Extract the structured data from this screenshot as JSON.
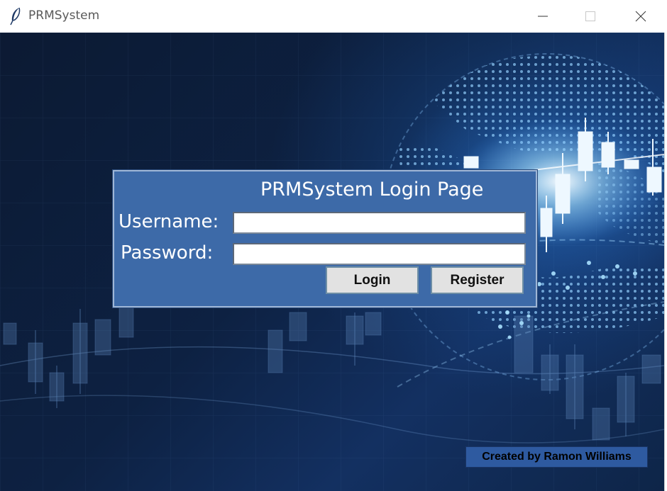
{
  "window": {
    "title": "PRMSystem",
    "controls": {
      "minimize_icon": "minimize-icon",
      "maximize_icon": "maximize-icon",
      "close_icon": "close-icon"
    }
  },
  "login": {
    "title": "PRMSystem Login Page",
    "username_label": "Username:",
    "password_label": "Password:",
    "username_value": "",
    "password_value": "",
    "login_button": "Login",
    "register_button": "Register"
  },
  "footer": {
    "credit": "Created by Ramon Williams"
  },
  "colors": {
    "panel": "#3d6aa8",
    "background": "#0d2142",
    "credit_badge": "#2e5aa0"
  }
}
